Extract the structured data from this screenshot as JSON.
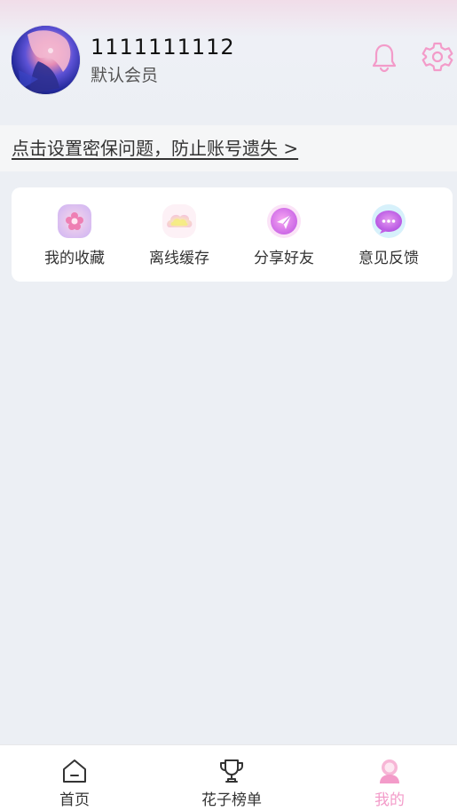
{
  "profile": {
    "user_id": "1111111112",
    "member_level": "默认会员"
  },
  "header_icons": {
    "notification": "bell-icon",
    "settings": "gear-icon"
  },
  "banner": {
    "text": "点击设置密保问题，防止账号遗失 >"
  },
  "features": [
    {
      "label": "我的收藏",
      "icon": "flower-icon",
      "color": "#d9a3f0"
    },
    {
      "label": "离线缓存",
      "icon": "cloud-icon",
      "color": "#f6ea8a"
    },
    {
      "label": "分享好友",
      "icon": "paper-plane-icon",
      "color": "#e676ee"
    },
    {
      "label": "意见反馈",
      "icon": "chat-bubble-icon",
      "color": "#c85ae6"
    }
  ],
  "bottom_nav": [
    {
      "label": "首页",
      "icon": "home-icon",
      "active": false
    },
    {
      "label": "花子榜单",
      "icon": "trophy-icon",
      "active": false
    },
    {
      "label": "我的",
      "icon": "profile-icon",
      "active": true
    }
  ],
  "colors": {
    "accent": "#f39bc9",
    "page_background": "#eceff4"
  }
}
